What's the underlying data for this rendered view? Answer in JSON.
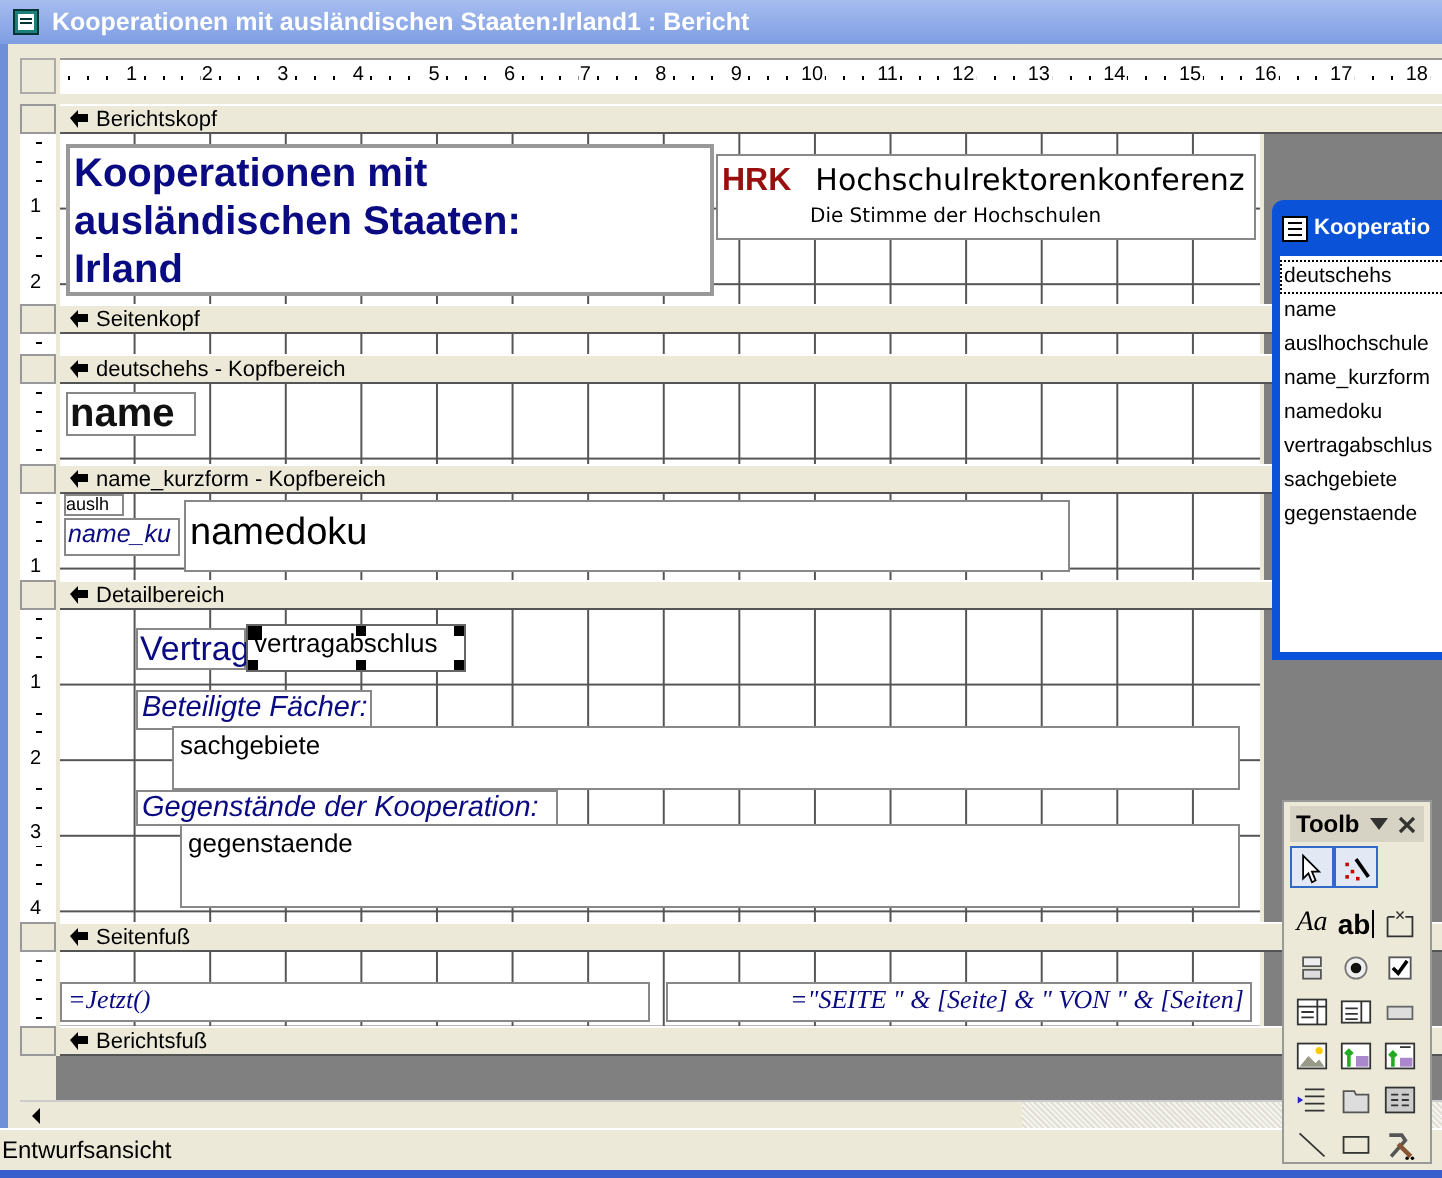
{
  "window": {
    "title": "Kooperationen mit ausländischen Staaten:Irland1 : Bericht"
  },
  "ruler": {
    "marks": [
      "1",
      "2",
      "3",
      "4",
      "5",
      "6",
      "7",
      "8",
      "9",
      "10",
      "11",
      "12",
      "13",
      "14",
      "15",
      "16",
      "17",
      "18"
    ]
  },
  "sections": [
    {
      "title": "Berichtskopf",
      "ruler_marks": [
        "1",
        "2"
      ],
      "controls": [
        {
          "kind": "title",
          "text": "Kooperationen mit ausländischen Staaten: Irland",
          "selected": false
        },
        {
          "kind": "logo",
          "mark": "HRK",
          "name": "Hochschulrektorenkonferenz",
          "tagline": "Die Stimme der Hochschulen",
          "selected": false
        }
      ]
    },
    {
      "title": "Seitenkopf"
    },
    {
      "title": "deutschehs - Kopfbereich",
      "controls": [
        {
          "kind": "heading-field",
          "text": "name",
          "selected": false
        }
      ]
    },
    {
      "title": "name_kurzform - Kopfbereich",
      "ruler_marks": [
        "1"
      ],
      "controls": [
        {
          "kind": "small-field",
          "text": "auslh",
          "selected": false
        },
        {
          "kind": "italic-label",
          "text": "name_ku",
          "selected": false
        },
        {
          "kind": "large-field",
          "text": "namedoku",
          "selected": false
        }
      ]
    },
    {
      "title": "Detailbereich",
      "ruler_marks": [
        "1",
        "2",
        "3",
        "4"
      ],
      "controls": [
        {
          "kind": "label",
          "text": "Vertrag",
          "selected": false
        },
        {
          "kind": "field",
          "text": "vertragabschlus",
          "selected": true
        },
        {
          "kind": "italic-label",
          "text": "Beteiligte Fächer:",
          "selected": false
        },
        {
          "kind": "field",
          "text": "sachgebiete",
          "selected": false
        },
        {
          "kind": "italic-label",
          "text": "Gegenstände der Kooperation:",
          "selected": false
        },
        {
          "kind": "field",
          "text": "gegenstaende",
          "selected": false
        }
      ]
    },
    {
      "title": "Seitenfuß",
      "controls": [
        {
          "kind": "formula",
          "text": "=Jetzt()",
          "selected": false
        },
        {
          "kind": "formula",
          "text": "=\"SEITE \" & [Seite] & \" VON \" & [Seiten]",
          "selected": false
        }
      ]
    },
    {
      "title": "Berichtsfuß"
    }
  ],
  "field_list": {
    "title": "Kooperatio",
    "fields": [
      {
        "name": "deutschehs",
        "selected": true
      },
      {
        "name": "name",
        "selected": false
      },
      {
        "name": "auslhochschule",
        "selected": false
      },
      {
        "name": "name_kurzform",
        "selected": false
      },
      {
        "name": "namedoku",
        "selected": false
      },
      {
        "name": "vertragabschlus",
        "selected": false
      },
      {
        "name": "sachgebiete",
        "selected": false
      },
      {
        "name": "gegenstaende",
        "selected": false
      }
    ]
  },
  "toolbox": {
    "title": "Toolb",
    "tools": [
      {
        "kind": "pointer",
        "pressed": true
      },
      {
        "kind": "wizard",
        "pressed": true
      },
      {
        "kind": "label",
        "glyph": "Aa",
        "pressed": false
      },
      {
        "kind": "textbox",
        "glyph": "ab",
        "pressed": false
      },
      {
        "kind": "option-group",
        "pressed": false
      },
      {
        "kind": "toggle",
        "pressed": false
      },
      {
        "kind": "radio",
        "pressed": false
      },
      {
        "kind": "checkbox",
        "pressed": false
      },
      {
        "kind": "combo",
        "pressed": false
      },
      {
        "kind": "listbox",
        "pressed": false
      },
      {
        "kind": "command",
        "pressed": false
      },
      {
        "kind": "image",
        "pressed": false
      },
      {
        "kind": "unbound-object",
        "pressed": false
      },
      {
        "kind": "bound-object",
        "pressed": false
      },
      {
        "kind": "page-break",
        "pressed": false
      },
      {
        "kind": "tab",
        "pressed": false
      },
      {
        "kind": "subform",
        "pressed": false
      },
      {
        "kind": "line",
        "pressed": false
      },
      {
        "kind": "rectangle",
        "pressed": false
      },
      {
        "kind": "more",
        "pressed": false
      }
    ]
  },
  "status_bar": {
    "text": "Entwurfsansicht"
  }
}
